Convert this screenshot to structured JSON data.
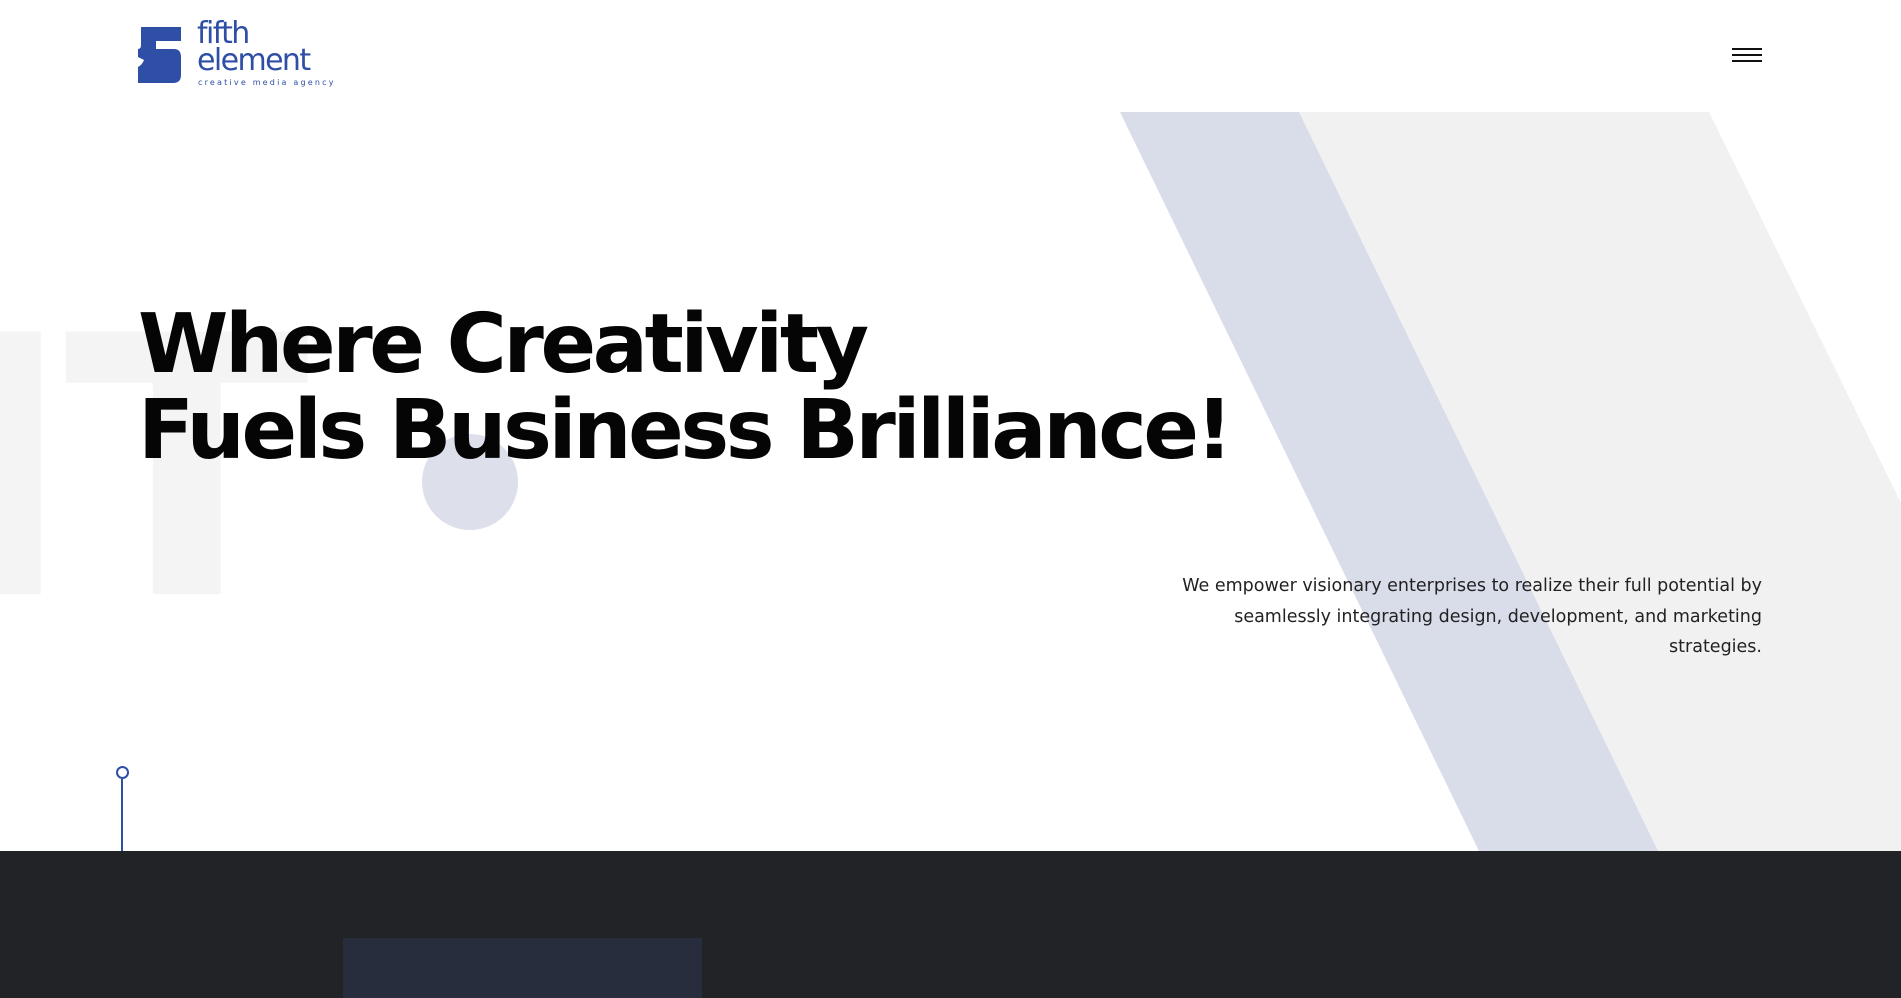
{
  "header": {
    "logo": {
      "word_line1": "fifth",
      "word_line2": "element",
      "tagline": "creative media agency"
    },
    "menu_icon": "hamburger-menu-icon"
  },
  "hero": {
    "headline_line1": "Where Creativity",
    "headline_line2": "Fuels Business Brilliance!",
    "lead": "We empower visionary enterprises to realize their full potential by seamlessly integrating design, development, and marketing strategies.",
    "background_letter": "IT"
  },
  "colors": {
    "brand_blue": "#2f4ea5",
    "stripe_blue": "#d9dce9",
    "stripe_gray": "#f1f1f1",
    "dark_section": "#222326",
    "dark_card": "#272d3d",
    "headline": "#050505"
  }
}
